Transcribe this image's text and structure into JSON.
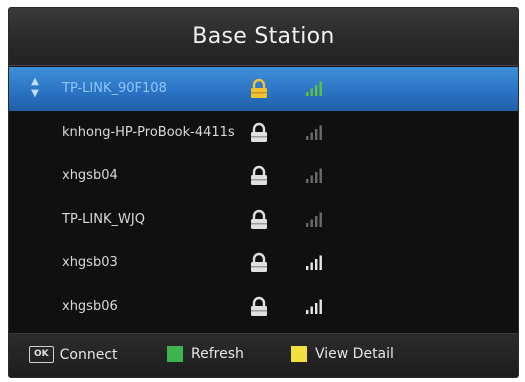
{
  "window": {
    "title": "Base Station"
  },
  "networks": [
    {
      "ssid": "TP-LINK_90F108",
      "secured": true,
      "selected": true,
      "signal_level": 4
    },
    {
      "ssid": "knhong-HP-ProBook-4411s",
      "secured": true,
      "selected": false,
      "signal_level": 1
    },
    {
      "ssid": "xhgsb04",
      "secured": true,
      "selected": false,
      "signal_level": 1
    },
    {
      "ssid": "TP-LINK_WJQ",
      "secured": true,
      "selected": false,
      "signal_level": 1
    },
    {
      "ssid": "xhgsb03",
      "secured": true,
      "selected": false,
      "signal_level": 4
    },
    {
      "ssid": "xhgsb06",
      "secured": true,
      "selected": false,
      "signal_level": 4
    }
  ],
  "footer": {
    "ok_key": "OK",
    "connect_label": "Connect",
    "refresh_label": "Refresh",
    "view_detail_label": "View Detail"
  },
  "colors": {
    "selected_row": "#2b74c4",
    "lock_selected": "#f2c230",
    "lock_default": "#e0e0e0",
    "signal_selected": "#5cc43a",
    "refresh_key": "#3fb34f",
    "view_detail_key": "#f0e040"
  },
  "icons": {
    "scroll": "up-down-arrow-icon",
    "lock": "lock-icon",
    "signal": "signal-strength-icon",
    "ok": "ok-key-icon",
    "refresh": "green-key-icon",
    "view_detail": "yellow-key-icon"
  }
}
